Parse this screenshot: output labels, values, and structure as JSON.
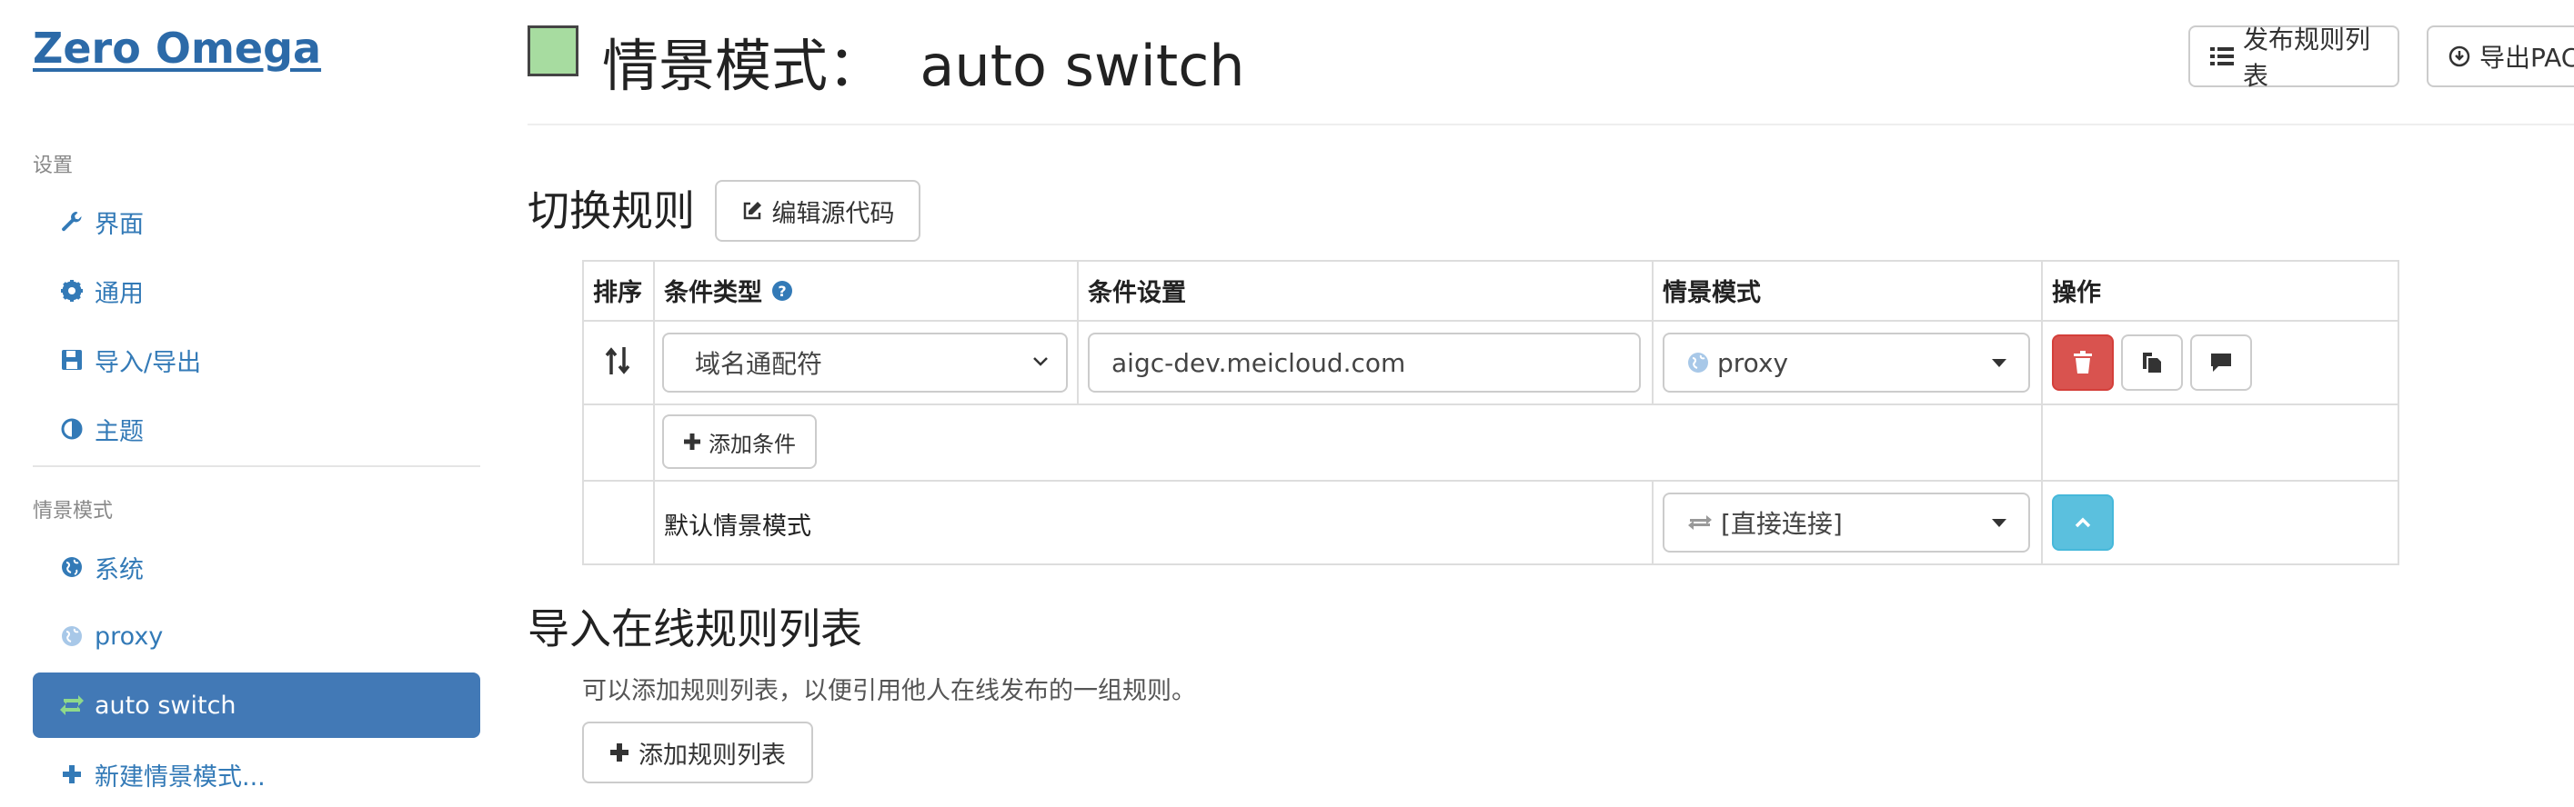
{
  "sidebar": {
    "brand": "Zero Omega",
    "settings_header": "设置",
    "settings_items": [
      {
        "label": "界面",
        "icon": "wrench-icon"
      },
      {
        "label": "通用",
        "icon": "gear-icon"
      },
      {
        "label": "导入/导出",
        "icon": "floppy-disk-icon"
      },
      {
        "label": "主题",
        "icon": "contrast-icon"
      }
    ],
    "profiles_header": "情景模式",
    "profile_items": [
      {
        "label": "系统",
        "icon": "globe-icon"
      },
      {
        "label": "proxy",
        "icon": "globe-light-icon"
      },
      {
        "label": "auto switch",
        "icon": "switch-arrows-icon",
        "active": true
      },
      {
        "label": "新建情景模式...",
        "icon": "plus-icon"
      }
    ]
  },
  "header": {
    "title": "情景模式：  auto switch",
    "swatch_color": "#a7dca0",
    "publish_label": "发布规则列表",
    "export_label": "导出PAC"
  },
  "switch_rules": {
    "heading": "切换规则",
    "edit_source_label": "编辑源代码",
    "columns": [
      "排序",
      "条件类型",
      "条件设置",
      "情景模式",
      "操作"
    ],
    "rows": [
      {
        "condition_type": "域名通配符",
        "condition": "aigc-dev.meicloud.com",
        "profile": "proxy"
      }
    ],
    "add_condition_label": "添加条件",
    "default_label": "默认情景模式",
    "default_profile": "[直接连接]"
  },
  "online_rules": {
    "heading": "导入在线规则列表",
    "description": "可以添加规则列表，以便引用他人在线发布的一组规则。",
    "add_label": "添加规则列表"
  },
  "colors": {
    "accent": "#4279b6",
    "link": "#337ab7",
    "danger": "#d9534f",
    "info": "#5bc0de"
  }
}
